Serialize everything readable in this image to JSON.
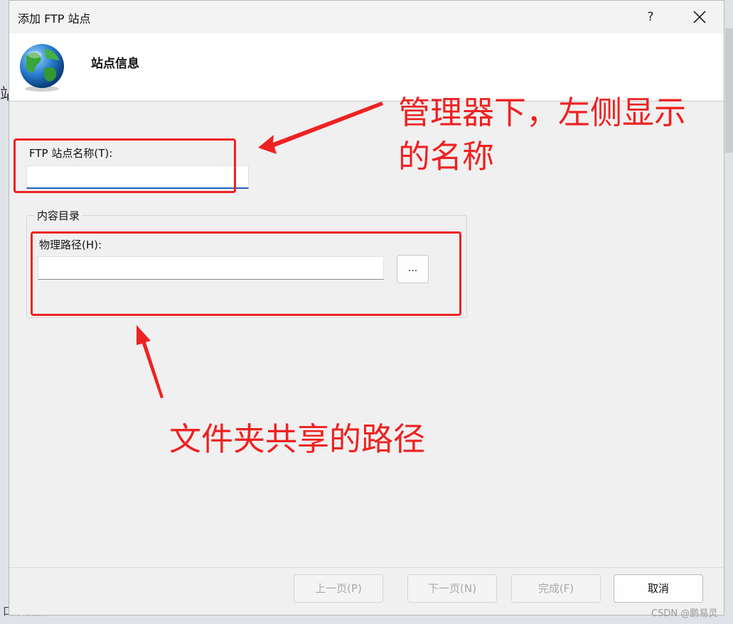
{
  "window": {
    "title": "添加 FTP 站点",
    "help_label": "?"
  },
  "header": {
    "title": "站点信息"
  },
  "form": {
    "site_name_label": "FTP 站点名称(T):",
    "site_name_value": "",
    "content_group_title": "内容目录",
    "physical_path_label": "物理路径(H):",
    "physical_path_value": "",
    "browse_label": "..."
  },
  "footer": {
    "prev_label": "上一页(P)",
    "next_label": "下一页(N)",
    "finish_label": "完成(F)",
    "cancel_label": "取消"
  },
  "annotations": {
    "site_name_note_line1": "管理器下，左侧显示",
    "site_name_note_line2": "的名称",
    "path_note": "文件夹共享的路径",
    "color": "#ee2222"
  },
  "background": {
    "left_glyph": "站",
    "bottom_text": "口下载点"
  },
  "watermark": "CSDN @鹏易灵"
}
